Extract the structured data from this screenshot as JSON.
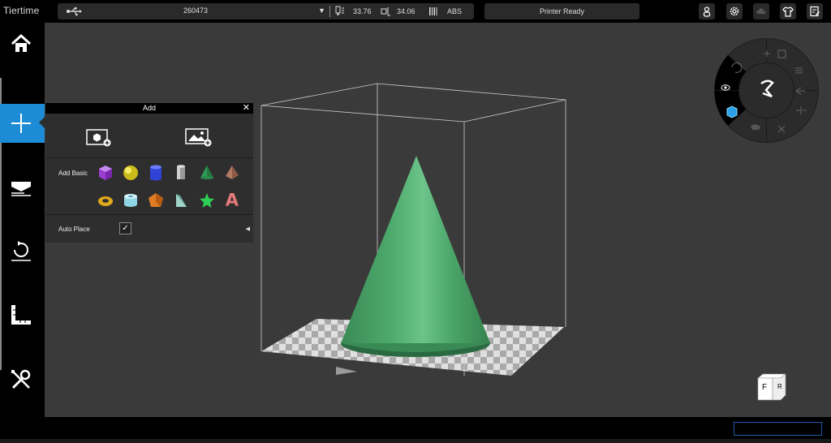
{
  "app": {
    "logo": "Tiertime"
  },
  "status": {
    "serial": "260473",
    "dropdown": "▼",
    "nozzle_temp": "33.76",
    "bed_temp": "34.06",
    "material": "ABS",
    "printer_state": "Printer Ready"
  },
  "add_panel": {
    "title": "Add",
    "close": "✕",
    "add_basic_label": "Add Basic",
    "auto_place_label": "Auto Place",
    "auto_place_checked": "✓",
    "collapse_arrow": "◀",
    "shapes": [
      "cube",
      "sphere",
      "cylinder",
      "gray-cylinder",
      "cone",
      "pyramid",
      "torus",
      "tube",
      "pentagon",
      "wedge",
      "star",
      "letter-a"
    ],
    "shape_letter": "A"
  },
  "viewcube": {
    "front": "F",
    "right": "R"
  },
  "model": {
    "name": "cone",
    "color": "#46a266"
  }
}
